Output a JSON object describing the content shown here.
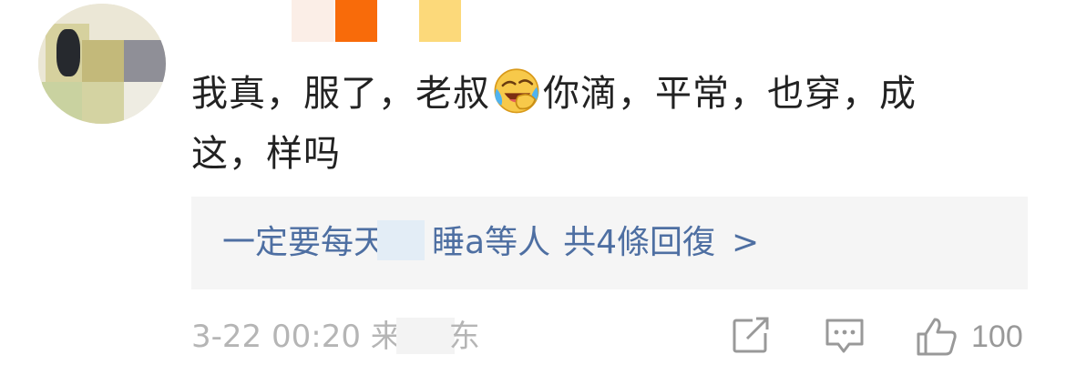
{
  "comment": {
    "text_line1": "我真，服了，老叔",
    "emoji": "laughing-crying-emoji",
    "text_line1_rest": "你滴，平常，也穿，成",
    "text_line2": "这，样吗"
  },
  "reply": {
    "author_prefix": "一定要每天",
    "author_suffix": "睡a等人",
    "count_text": "共4條回復",
    "chevron": ">"
  },
  "footer": {
    "timestamp": "3-22 00:20",
    "location_prefix": "来",
    "location_suffix": "东",
    "like_count": "100",
    "icons": [
      "share-icon",
      "comment-icon",
      "like-icon"
    ]
  },
  "colors": {
    "link": "#4e6fa2",
    "text": "#222222",
    "meta": "#b5b5b5",
    "reply_bg": "#f5f5f5"
  }
}
